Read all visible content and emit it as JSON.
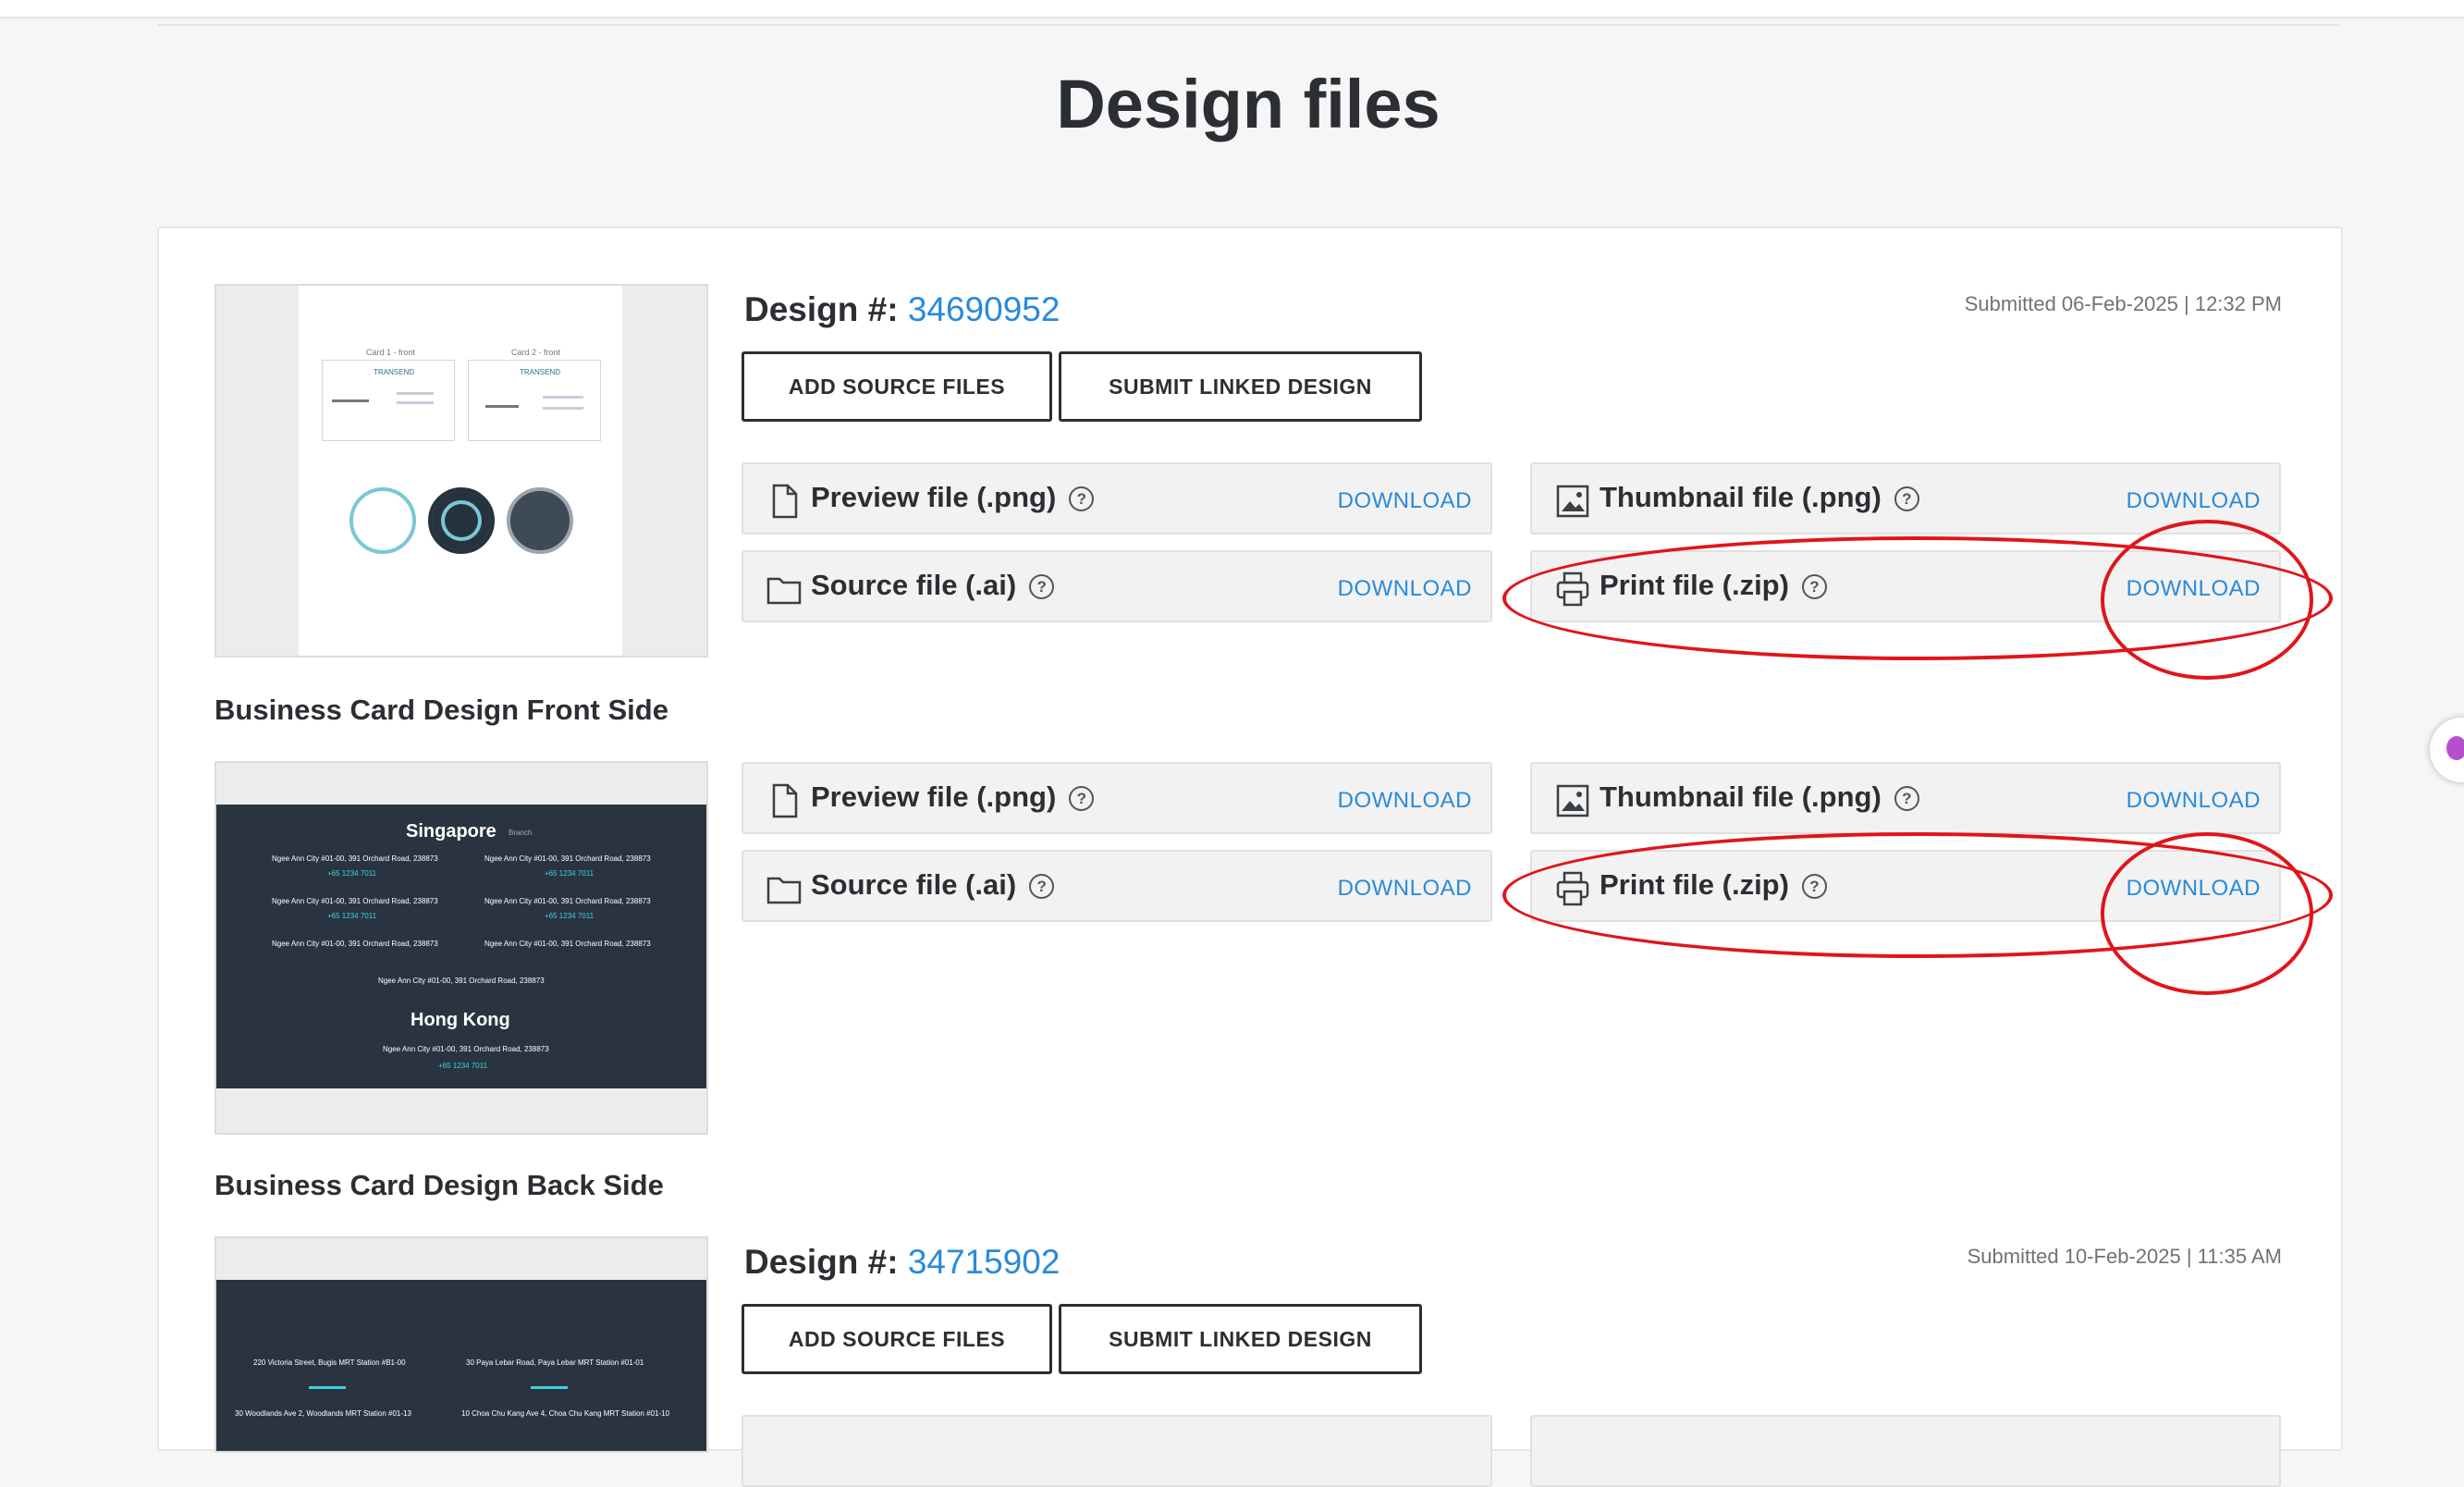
{
  "page_title": "Design files",
  "sections": [
    {
      "label": "",
      "design_label": "Design #:",
      "design_number": "34690952",
      "submitted": "Submitted 06-Feb-2025 | 12:32 PM",
      "buttons": {
        "add_source": "ADD SOURCE FILES",
        "submit_linked": "SUBMIT LINKED DESIGN"
      },
      "thumb_text": {
        "card1": "Card 1 - front",
        "card2": "Card 2 - front",
        "brand": "TRANSEND"
      }
    },
    {
      "label": "Business Card Design Front Side",
      "thumb_text": {
        "city1": "Singapore",
        "city2": "Hong Kong",
        "branch": "Branch",
        "addr": "Ngee Ann City #01-00, 391 Orchard Road, 238873",
        "phone": "+65 1234 7011"
      }
    },
    {
      "label": "Business Card Design Back Side",
      "design_label": "Design #:",
      "design_number": "34715902",
      "submitted": "Submitted 10-Feb-2025 | 11:35 AM",
      "buttons": {
        "add_source": "ADD SOURCE FILES",
        "submit_linked": "SUBMIT LINKED DESIGN"
      },
      "thumb_text": {
        "a1": "220 Victoria Street, Bugis MRT Station #B1-00",
        "a2": "30 Paya Lebar Road, Paya Lebar MRT Station #01-01",
        "a3": "30 Woodlands Ave 2, Woodlands MRT Station #01-13",
        "a4": "10 Choa Chu Kang Ave 4, Choa Chu Kang MRT Station #01-10"
      }
    }
  ],
  "file_rows": {
    "preview": "Preview file (.png)",
    "thumbnail": "Thumbnail file (.png)",
    "source": "Source file (.ai)",
    "print": "Print file (.zip)",
    "download": "DOWNLOAD"
  },
  "icons": [
    "file-icon",
    "image-icon",
    "folder-icon",
    "printer-icon",
    "help-icon"
  ],
  "colors": {
    "link": "#2a8ad9",
    "annotation": "#e0151b",
    "dark": "#2b2f33"
  }
}
